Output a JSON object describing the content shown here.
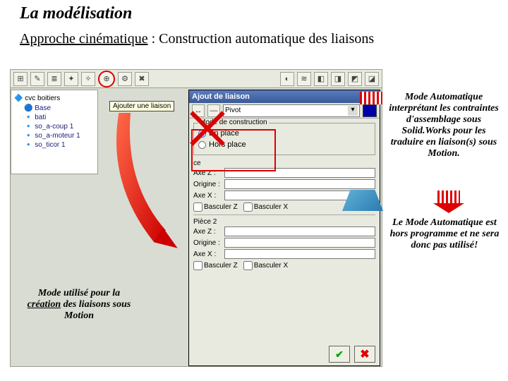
{
  "title": "La modélisation",
  "subtitle_underline": "Approche cinématique",
  "subtitle_rest": " : Construction automatique des liaisons",
  "annot": {
    "right1": "Mode Automatique interprétant les contraintes d'assemblage sous Solid.Works pour les traduire en liaison(s) sous Motion.",
    "right2": "Le Mode Automatique est hors programme et ne sera donc pas utilisé!",
    "left_pre": "Mode utilisé pour la ",
    "left_ul": "création",
    "left_post": " des liaisons sous Motion"
  },
  "tree": {
    "root_icon": "cvc",
    "root": "boitiers",
    "group": "Base",
    "items": [
      "bati",
      "so_a-coup 1",
      "so_a-moteur 1",
      "so_ticor 1"
    ]
  },
  "tooltip": "Ajouter une liaison",
  "dialog": {
    "title": "Ajout de liaison",
    "close": "×",
    "dropdown": "Pivot",
    "groupbox_legend": "Mode de construction",
    "radio_en_place": "En place",
    "radio_hors_place": "Hors place",
    "piece1": "ce",
    "piece2": "Pièce 2",
    "fields": [
      "Axe Z :",
      "Origine :",
      "Axe X :"
    ],
    "check_z": "Basculer Z",
    "check_x": "Basculer X"
  }
}
